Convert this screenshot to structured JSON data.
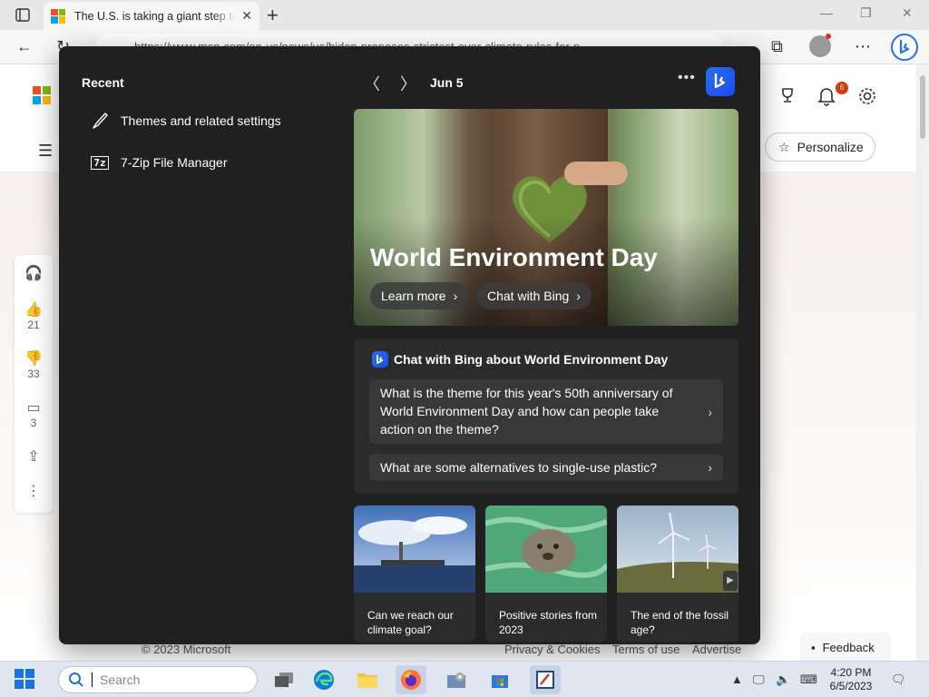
{
  "browser": {
    "tab_title": "The U.S. is taking a giant step toward",
    "url": "https://www.msn.com/en-us/news/us/biden-proposes-strictest-ever-climate-rules-for-p...",
    "notification_count": "6",
    "personalize_label": "Personalize"
  },
  "page": {
    "rail": {
      "likes": "21",
      "dislikes": "33",
      "comments": "3"
    },
    "footer": {
      "copyright": "© 2023 Microsoft",
      "privacy": "Privacy & Cookies",
      "terms": "Terms of use",
      "advertise": "Advertise"
    },
    "feedback_label": "Feedback"
  },
  "flyout": {
    "recent_title": "Recent",
    "recent_items": [
      {
        "label": "Themes and related settings",
        "icon": "paintbrush-icon"
      },
      {
        "label": "7-Zip File Manager",
        "icon": "7zip-icon",
        "icon_text": "7z"
      }
    ],
    "date": "Jun 5",
    "hero": {
      "title": "World Environment Day",
      "learn_more": "Learn more",
      "chat_with_bing": "Chat with Bing"
    },
    "chat": {
      "heading": "Chat with Bing about World Environment Day",
      "questions": [
        "What is the theme for this year's 50th anniversary of World Environment Day and how can people take action on the theme?",
        "What are some alternatives to single-use plastic?"
      ]
    },
    "cards": [
      {
        "caption": "Can we reach our climate goal?"
      },
      {
        "caption": "Positive stories from 2023"
      },
      {
        "caption": "The end of the fossil age?"
      }
    ]
  },
  "taskbar": {
    "search_placeholder": "Search",
    "time": "4:20 PM",
    "date": "6/5/2023"
  },
  "colors": {
    "flyout_bg": "#202020",
    "bing_blue": "#2870ea",
    "taskbar_bg": "#dfe6ef"
  }
}
